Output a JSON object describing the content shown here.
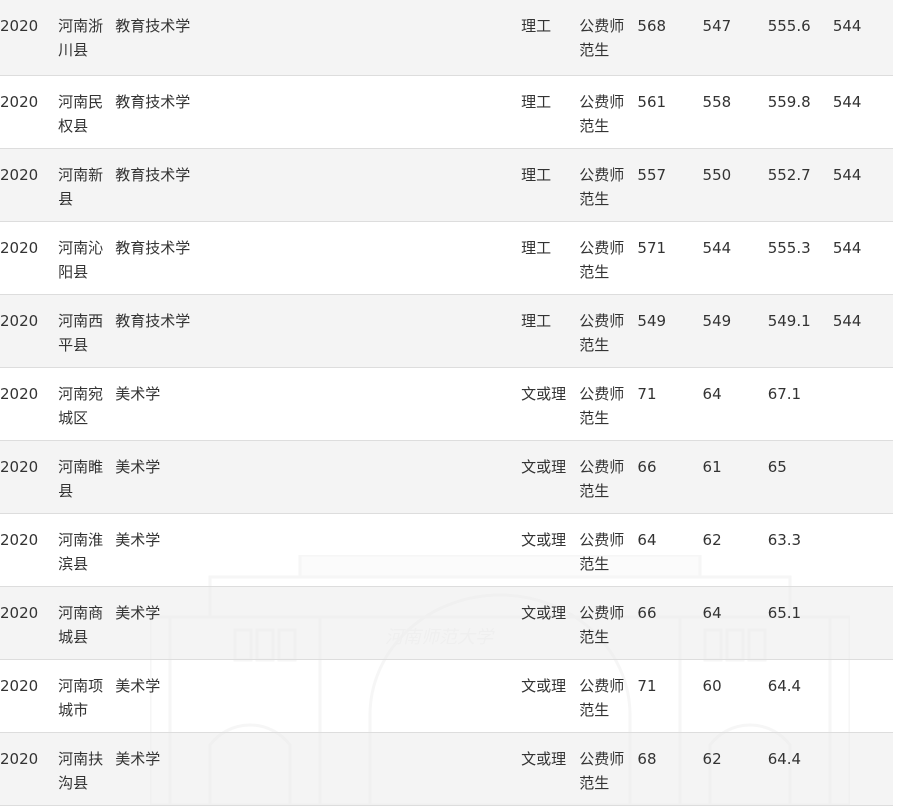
{
  "watermark": {
    "text": "河南师范大学"
  },
  "rows": [
    {
      "year": "2020",
      "region": "河南浙川县",
      "major": "教育技术学",
      "subject": "理工",
      "type": "公费师范生",
      "max": "568",
      "min": "547",
      "avg": "555.6",
      "line": "544"
    },
    {
      "year": "2020",
      "region": "河南民权县",
      "major": "教育技术学",
      "subject": "理工",
      "type": "公费师范生",
      "max": "561",
      "min": "558",
      "avg": "559.8",
      "line": "544"
    },
    {
      "year": "2020",
      "region": "河南新县",
      "major": "教育技术学",
      "subject": "理工",
      "type": "公费师范生",
      "max": "557",
      "min": "550",
      "avg": "552.7",
      "line": "544"
    },
    {
      "year": "2020",
      "region": "河南沁阳县",
      "major": "教育技术学",
      "subject": "理工",
      "type": "公费师范生",
      "max": "571",
      "min": "544",
      "avg": "555.3",
      "line": "544"
    },
    {
      "year": "2020",
      "region": "河南西平县",
      "major": "教育技术学",
      "subject": "理工",
      "type": "公费师范生",
      "max": "549",
      "min": "549",
      "avg": "549.1",
      "line": "544"
    },
    {
      "year": "2020",
      "region": "河南宛城区",
      "major": "美术学",
      "subject": "文或理",
      "type": "公费师范生",
      "max": "71",
      "min": "64",
      "avg": "67.1",
      "line": ""
    },
    {
      "year": "2020",
      "region": "河南睢县",
      "major": "美术学",
      "subject": "文或理",
      "type": "公费师范生",
      "max": "66",
      "min": "61",
      "avg": "65",
      "line": ""
    },
    {
      "year": "2020",
      "region": "河南淮滨县",
      "major": "美术学",
      "subject": "文或理",
      "type": "公费师范生",
      "max": "64",
      "min": "62",
      "avg": "63.3",
      "line": ""
    },
    {
      "year": "2020",
      "region": "河南商城县",
      "major": "美术学",
      "subject": "文或理",
      "type": "公费师范生",
      "max": "66",
      "min": "64",
      "avg": "65.1",
      "line": ""
    },
    {
      "year": "2020",
      "region": "河南项城市",
      "major": "美术学",
      "subject": "文或理",
      "type": "公费师范生",
      "max": "71",
      "min": "60",
      "avg": "64.4",
      "line": ""
    },
    {
      "year": "2020",
      "region": "河南扶沟县",
      "major": "美术学",
      "subject": "文或理",
      "type": "公费师范生",
      "max": "68",
      "min": "62",
      "avg": "64.4",
      "line": ""
    }
  ]
}
